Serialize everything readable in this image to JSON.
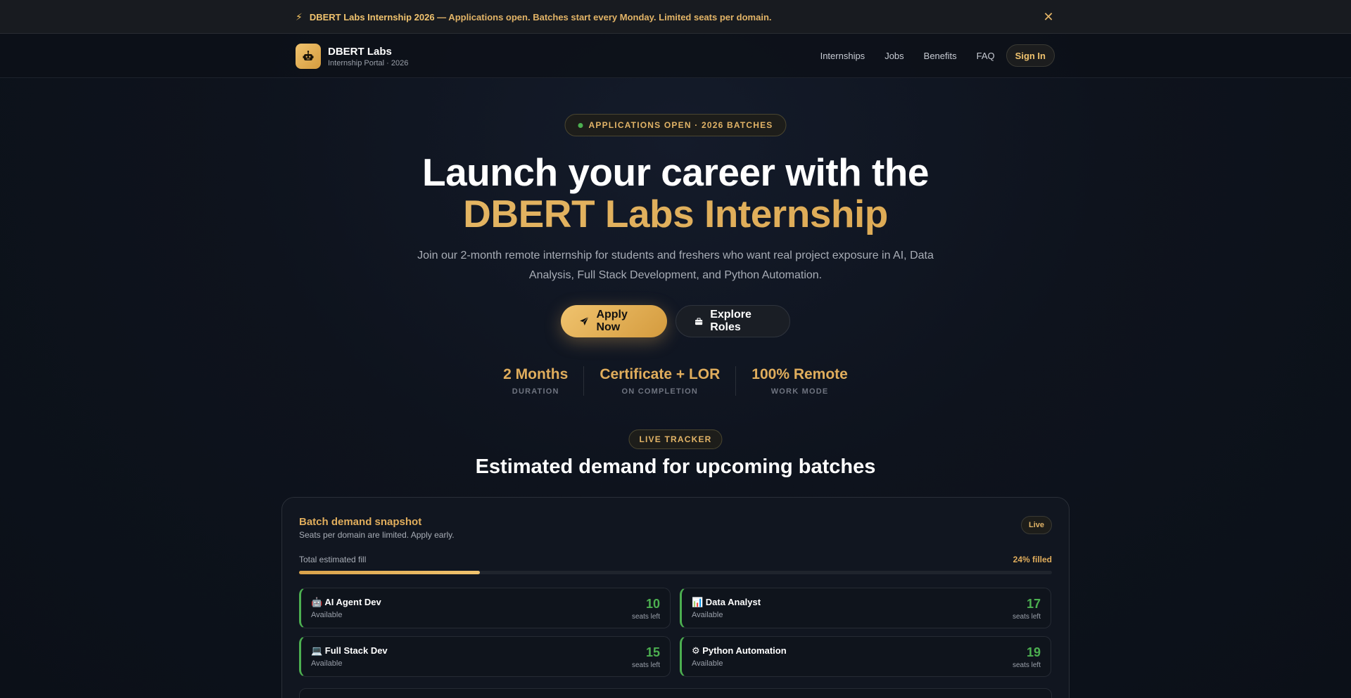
{
  "announcement": {
    "strong": "DBERT Labs Internship 2026",
    "text": " — Applications open. Batches start every Monday. Limited seats per domain.",
    "bolt_icon": "bolt-icon",
    "close_icon": "close-icon"
  },
  "nav": {
    "brand_name": "DBERT Labs",
    "brand_sub": "Internship Portal · 2026",
    "logo_icon": "robot-icon",
    "links": [
      "Internships",
      "Jobs",
      "Benefits",
      "FAQ"
    ],
    "signin": "Sign In"
  },
  "hero": {
    "badge": "APPLICATIONS OPEN · 2026 BATCHES",
    "title_line1": "Launch your career with the",
    "title_line2": "DBERT Labs Internship",
    "subtitle": "Join our 2-month remote internship for students and freshers who want real project exposure in AI, Data Analysis, Full Stack Development, and Python Automation.",
    "apply": "Apply Now",
    "explore": "Explore Roles",
    "stats": [
      {
        "value": "2 Months",
        "label": "DURATION"
      },
      {
        "value": "Certificate + LOR",
        "label": "ON COMPLETION"
      },
      {
        "value": "100% Remote",
        "label": "WORK MODE"
      }
    ]
  },
  "tracker": {
    "badge": "LIVE TRACKER",
    "title": "Estimated demand for upcoming batches",
    "card_title": "Batch demand snapshot",
    "card_sub": "Seats per domain are limited. Apply early.",
    "live": "Live",
    "fill_label": "Total estimated fill",
    "fill_pct_text": "24% filled",
    "fill_fraction": 0.24,
    "seats_label": "seats left",
    "domains": [
      {
        "name": "🤖 AI Agent Dev",
        "status": "Available",
        "seats": "10"
      },
      {
        "name": "📊 Data Analyst",
        "status": "Available",
        "seats": "17"
      },
      {
        "name": "💻 Full Stack Dev",
        "status": "Available",
        "seats": "15"
      },
      {
        "name": "⚙ Python Automation",
        "status": "Available",
        "seats": "19"
      }
    ]
  },
  "colors": {
    "accent": "#e0ad5c",
    "success": "#4caf50"
  }
}
